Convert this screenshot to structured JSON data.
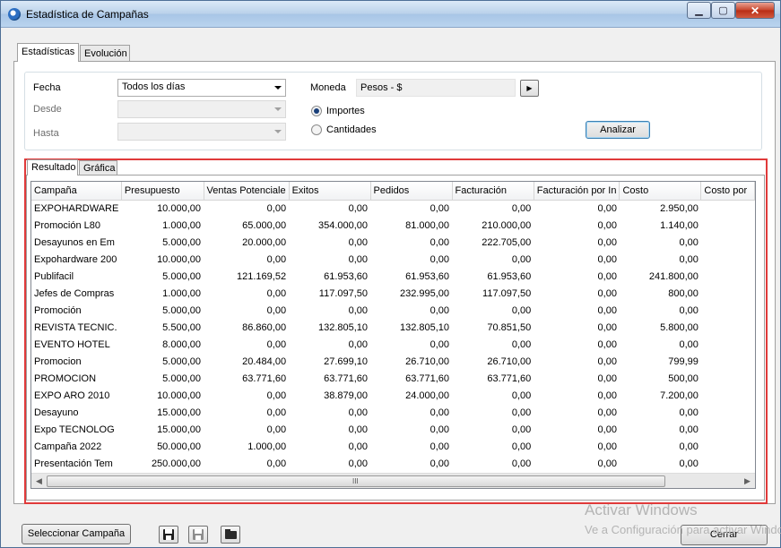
{
  "window": {
    "title": "Estadística de Campañas",
    "controls": {
      "minimize": "▁",
      "maximize": "▢",
      "close": "✕"
    }
  },
  "main_tabs": [
    {
      "label": "Estadísticas",
      "active": true
    },
    {
      "label": "Evolución",
      "active": false
    }
  ],
  "filters": {
    "fecha_label": "Fecha",
    "fecha_value": "Todos los días",
    "desde_label": "Desde",
    "desde_value": "",
    "hasta_label": "Hasta",
    "hasta_value": "",
    "moneda_label": "Moneda",
    "moneda_value": "Pesos - $",
    "moneda_button": "▶",
    "radio_importes": "Importes",
    "radio_cantidades": "Cantidades",
    "selected_radio": "Importes",
    "analizar_button": "Analizar"
  },
  "result_tabs": [
    {
      "label": "Resultado",
      "active": true
    },
    {
      "label": "Gráfica",
      "active": false
    }
  ],
  "table": {
    "columns": [
      "Campaña",
      "Presupuesto",
      "Ventas Potenciale",
      "Exitos",
      "Pedidos",
      "Facturación",
      "Facturación por In",
      "Costo",
      "Costo por"
    ],
    "rows": [
      [
        "EXPOHARDWARE",
        "10.000,00",
        "0,00",
        "0,00",
        "0,00",
        "0,00",
        "0,00",
        "2.950,00",
        ""
      ],
      [
        "Promoción L80",
        "1.000,00",
        "65.000,00",
        "354.000,00",
        "81.000,00",
        "210.000,00",
        "0,00",
        "1.140,00",
        ""
      ],
      [
        "Desayunos en Em",
        "5.000,00",
        "20.000,00",
        "0,00",
        "0,00",
        "222.705,00",
        "0,00",
        "0,00",
        ""
      ],
      [
        "Expohardware 200",
        "10.000,00",
        "0,00",
        "0,00",
        "0,00",
        "0,00",
        "0,00",
        "0,00",
        ""
      ],
      [
        "Publifacil",
        "5.000,00",
        "121.169,52",
        "61.953,60",
        "61.953,60",
        "61.953,60",
        "0,00",
        "241.800,00",
        ""
      ],
      [
        "Jefes de Compras",
        "1.000,00",
        "0,00",
        "117.097,50",
        "232.995,00",
        "117.097,50",
        "0,00",
        "800,00",
        ""
      ],
      [
        "Promoción",
        "5.000,00",
        "0,00",
        "0,00",
        "0,00",
        "0,00",
        "0,00",
        "0,00",
        ""
      ],
      [
        "REVISTA TECNIC.",
        "5.500,00",
        "86.860,00",
        "132.805,10",
        "132.805,10",
        "70.851,50",
        "0,00",
        "5.800,00",
        ""
      ],
      [
        "EVENTO HOTEL",
        "8.000,00",
        "0,00",
        "0,00",
        "0,00",
        "0,00",
        "0,00",
        "0,00",
        ""
      ],
      [
        "Promocion",
        "5.000,00",
        "20.484,00",
        "27.699,10",
        "26.710,00",
        "26.710,00",
        "0,00",
        "799,99",
        ""
      ],
      [
        "PROMOCION",
        "5.000,00",
        "63.771,60",
        "63.771,60",
        "63.771,60",
        "63.771,60",
        "0,00",
        "500,00",
        ""
      ],
      [
        "EXPO ARO 2010",
        "10.000,00",
        "0,00",
        "38.879,00",
        "24.000,00",
        "0,00",
        "0,00",
        "7.200,00",
        ""
      ],
      [
        "Desayuno",
        "15.000,00",
        "0,00",
        "0,00",
        "0,00",
        "0,00",
        "0,00",
        "0,00",
        ""
      ],
      [
        "Expo TECNOLOG",
        "15.000,00",
        "0,00",
        "0,00",
        "0,00",
        "0,00",
        "0,00",
        "0,00",
        ""
      ],
      [
        "Campaña 2022",
        "50.000,00",
        "1.000,00",
        "0,00",
        "0,00",
        "0,00",
        "0,00",
        "0,00",
        ""
      ],
      [
        "Presentación Tem",
        "250.000,00",
        "0,00",
        "0,00",
        "0,00",
        "0,00",
        "0,00",
        "0,00",
        ""
      ]
    ]
  },
  "scrollbar": {
    "left_arrow": "◀",
    "right_arrow": "▶",
    "grip": "III"
  },
  "footer": {
    "select_button": "Seleccionar Campaña",
    "close_button": "Cerrar"
  },
  "watermark": {
    "line1": "Activar Windows",
    "line2": "Ve a Configuración para activar Windows."
  },
  "colors": {
    "highlight_frame": "#e03a3a",
    "title_bar": "#b9d1ea"
  }
}
